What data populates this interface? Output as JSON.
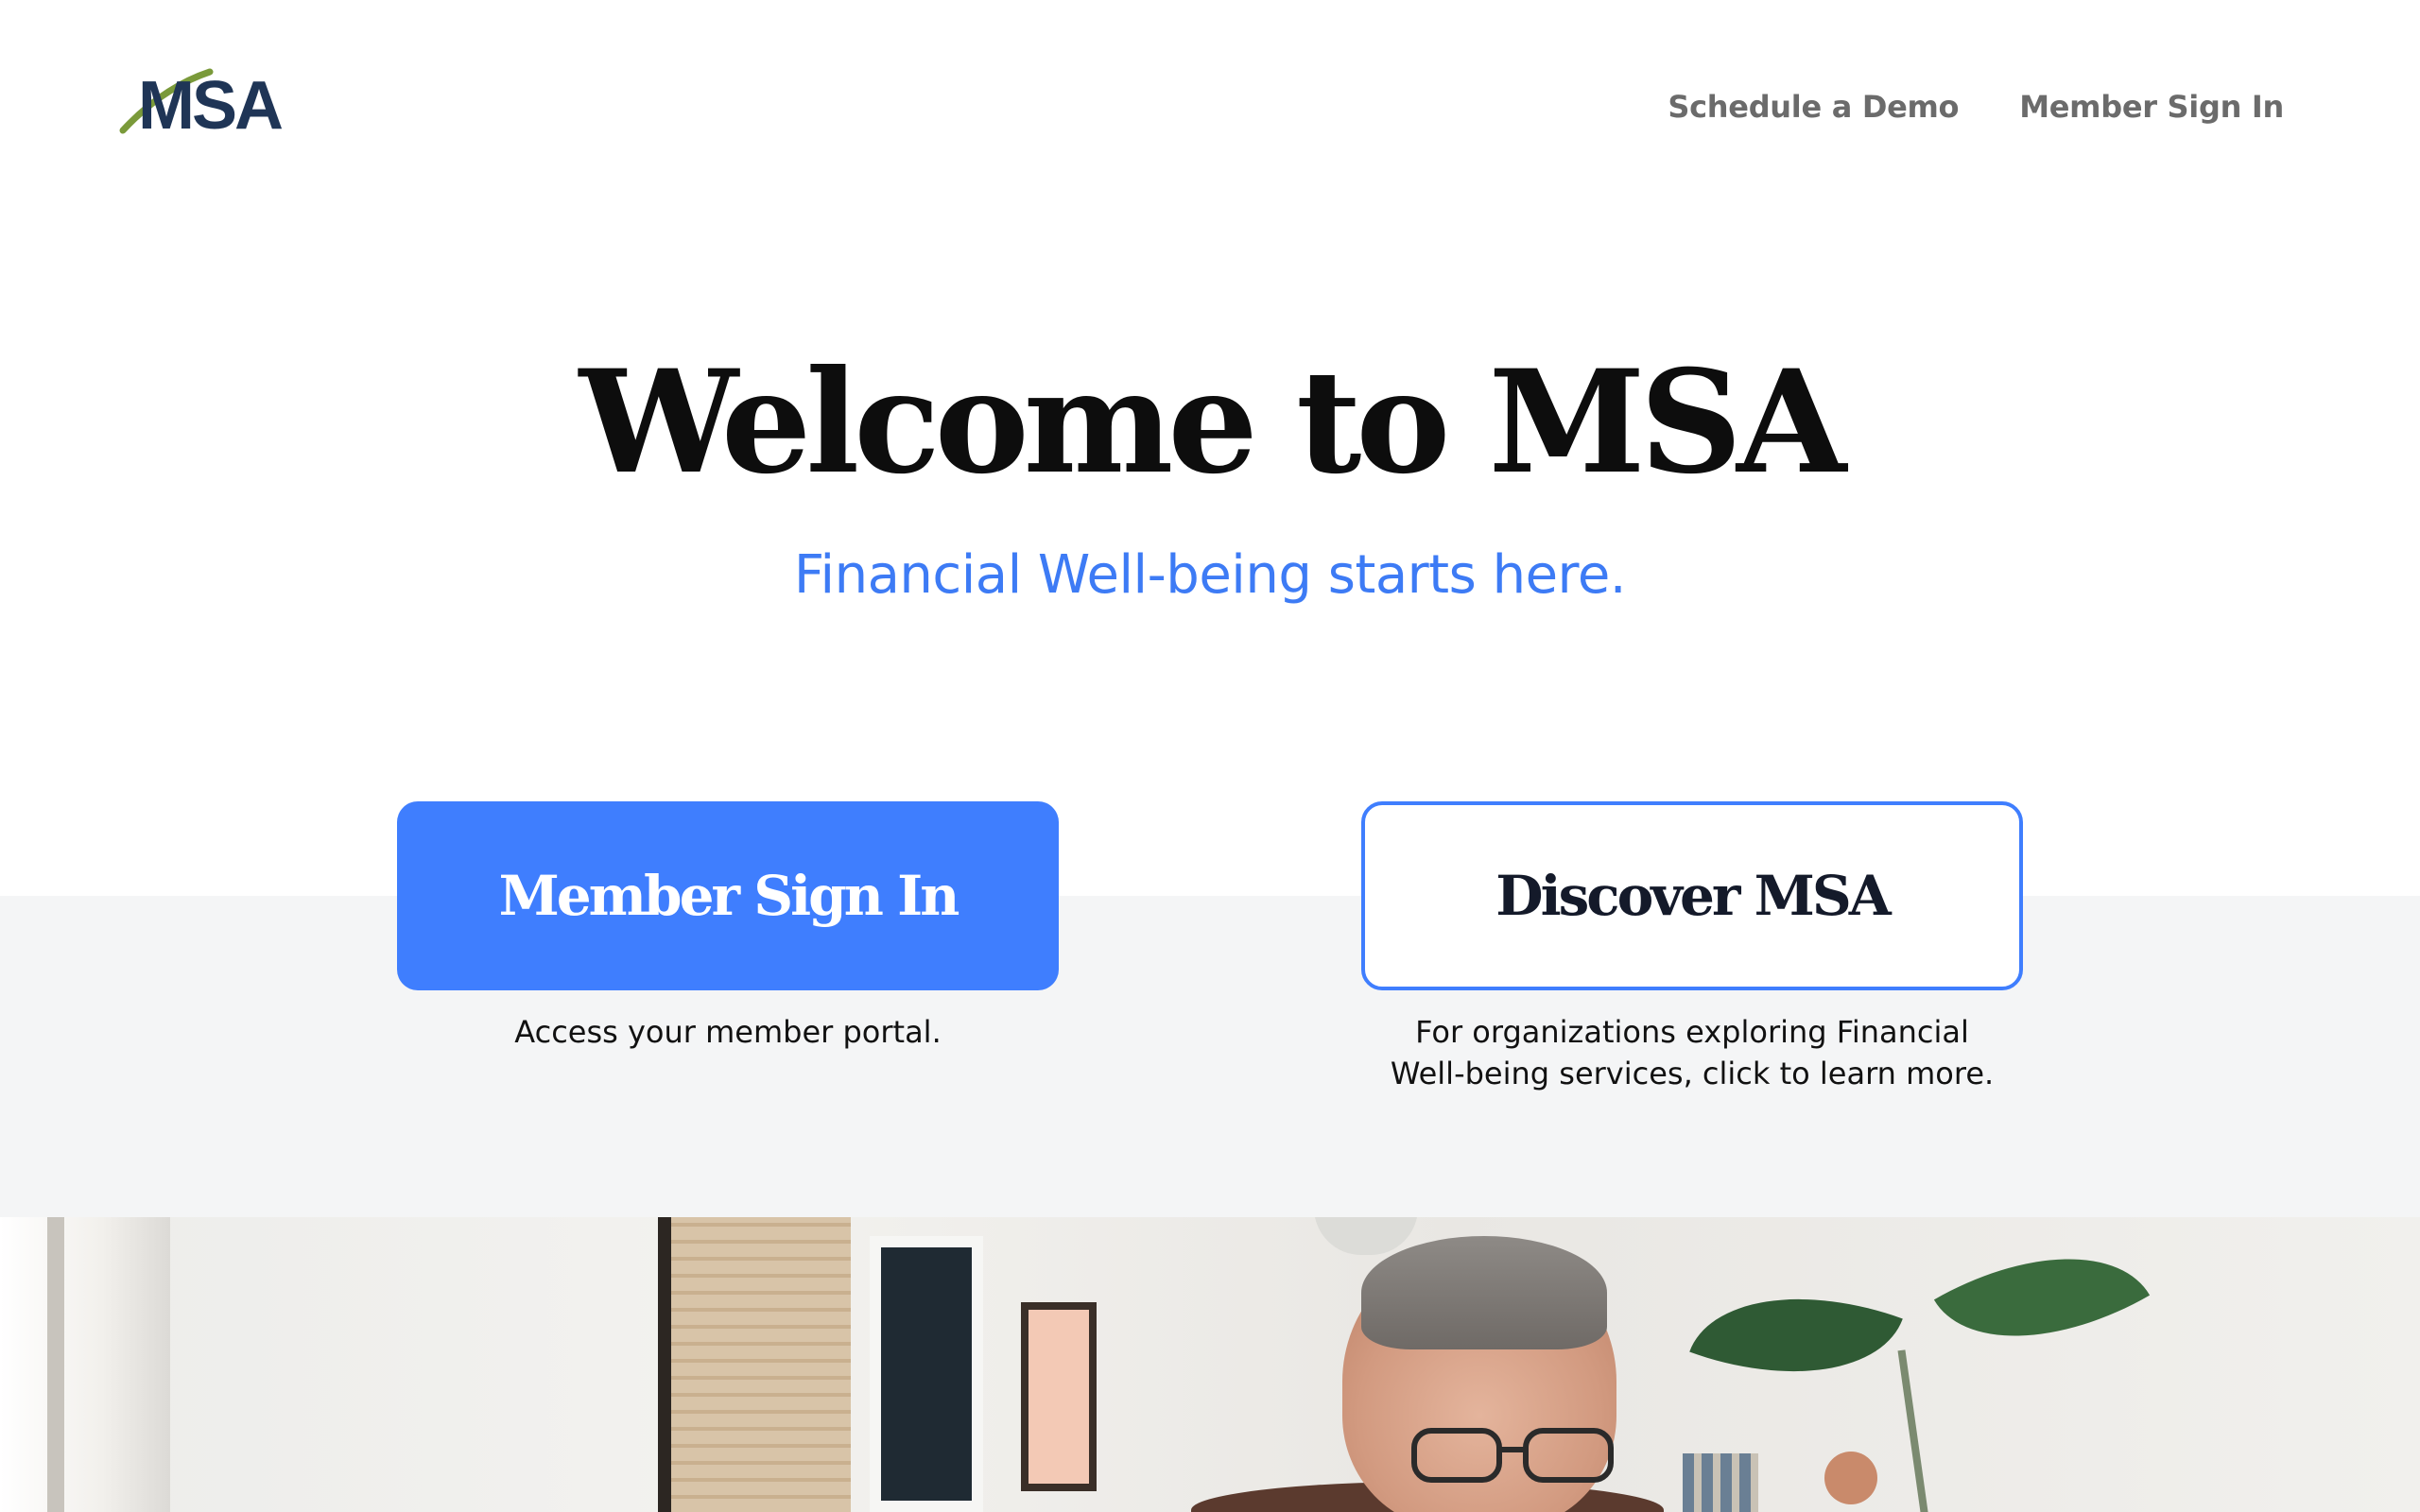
{
  "header": {
    "logo_text": "MSA",
    "nav": [
      {
        "label": "Schedule a Demo"
      },
      {
        "label": "Member Sign In"
      }
    ]
  },
  "hero": {
    "title": "Welcome to MSA",
    "subtitle": "Financial Well-being starts here."
  },
  "cta": {
    "primary": {
      "label": "Member Sign In",
      "description": "Access your member portal."
    },
    "secondary": {
      "label": "Discover MSA",
      "description": "For organizations exploring Financial Well-being services, click to learn more."
    }
  },
  "colors": {
    "accent": "#3f7efe",
    "subtitle": "#3d7bf5",
    "logo_navy": "#1f3556",
    "logo_green": "#7a9a3a",
    "band": "#f4f5f6"
  },
  "icons": [
    "msa-logo-icon",
    "logo-swoosh-icon"
  ]
}
